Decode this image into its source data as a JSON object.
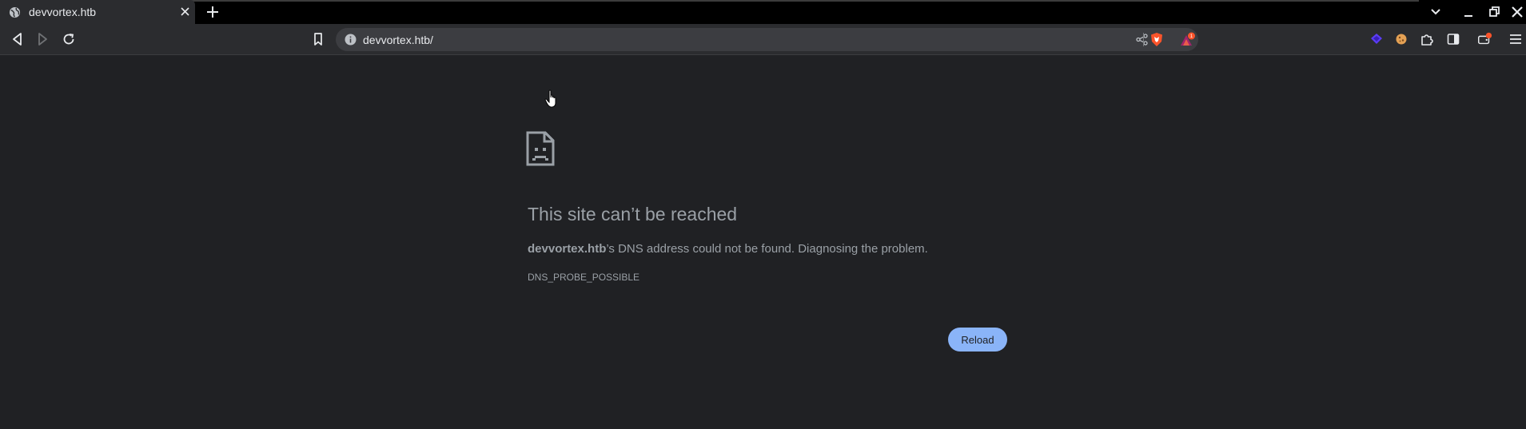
{
  "tab": {
    "title": "devvortex.htb",
    "icon": "globe-icon"
  },
  "omnibox": {
    "url": "devvortex.htb/",
    "rewards_badge": "1"
  },
  "error_page": {
    "heading": "This site can’t be reached",
    "host": "devvortex.htb",
    "message": "’s DNS address could not be found. Diagnosing the problem.",
    "error_code": "DNS_PROBE_POSSIBLE",
    "reload_label": "Reload"
  },
  "colors": {
    "page_bg": "#202124",
    "toolbar_bg": "#2b2c2f",
    "accent": "#8ab4f8",
    "muted_text": "#9aa0a6",
    "brave_orange": "#fb542b"
  }
}
